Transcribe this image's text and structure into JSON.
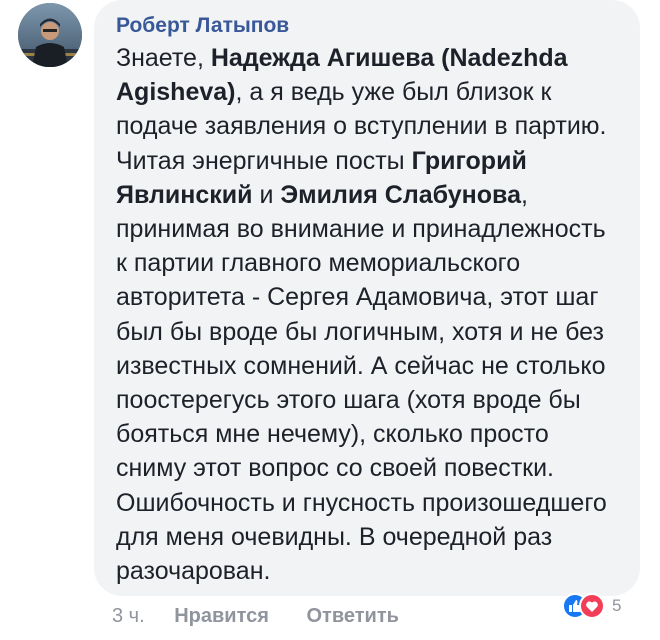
{
  "comment": {
    "author": "Роберт Латыпов",
    "text_parts": [
      {
        "text": "Знаете, ",
        "bold": false
      },
      {
        "text": "Надежда Агишева (Nadezhda Agisheva)",
        "bold": true
      },
      {
        "text": ", а я ведь уже был близок к подаче заявления о вступлении в партию. Читая энергичные посты ",
        "bold": false
      },
      {
        "text": "Григорий Явлинский",
        "bold": true
      },
      {
        "text": " и ",
        "bold": false
      },
      {
        "text": "Эмилия Слабунова",
        "bold": true
      },
      {
        "text": ", принимая во внимание и принадлежность к партии главного мемориальского авторитета - Сергея Адамовича, этот шаг был бы вроде бы логичным, хотя и не без известных сомнений. А сейчас не столько поостерегусь этого шага (хотя вроде бы бояться мне нечему), сколько просто сниму этот вопрос со своей повестки. Ошибочность и гнусность произошедшего для меня очевидны. В очередной раз разочарован.",
        "bold": false
      }
    ],
    "time": "3 ч.",
    "like_label": "Нравится",
    "reply_label": "Ответить",
    "reactions": {
      "icons": [
        "like-icon",
        "love-icon"
      ],
      "count": "5"
    }
  },
  "colors": {
    "author": "#385898",
    "bubble": "#f2f3f5",
    "like_reaction": "#1877f2",
    "love_reaction": "#f33e58",
    "meta_text": "#90949c"
  }
}
